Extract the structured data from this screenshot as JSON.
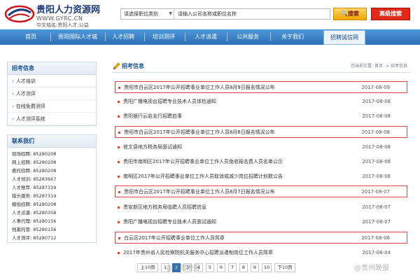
{
  "site": {
    "name": "贵阳人力资源网",
    "url": "WWW.GYRC.CN",
    "domain": "中文域名:贵阳人才.公益"
  },
  "search": {
    "category": "请选择职位类别",
    "input": "请输入公司名称或职位名称",
    "button": "搜索",
    "advanced": "高级搜索"
  },
  "nav": [
    "首页",
    "贵阳国际人才城",
    "人才招聘",
    "培训测评",
    "人才派遣",
    "公共服务",
    "关于我们",
    "招聘诚信网"
  ],
  "sidebar": {
    "recruit_title": "招考信息",
    "recruit_items": [
      "人才培训",
      "人才测评",
      "在线免费测评",
      "人才测评系统"
    ],
    "contact_title": "联系我们",
    "contacts": [
      {
        "label": "现场招聘:",
        "tel": "85280208"
      },
      {
        "label": "网上招聘:",
        "tel": "85280208"
      },
      {
        "label": "委托招聘:",
        "tel": "85280208"
      },
      {
        "label": "人才培训:",
        "tel": "85283667"
      },
      {
        "label": "人才推荐:",
        "tel": "85287319"
      },
      {
        "label": "猎头服务:",
        "tel": "85287319"
      },
      {
        "label": "报纸招聘:",
        "tel": "85280208"
      },
      {
        "label": "人才派遣:",
        "tel": "85280358"
      },
      {
        "label": "人事代理:",
        "tel": "85280156"
      },
      {
        "label": "档案托管:",
        "tel": "85280156"
      },
      {
        "label": "人才测评:",
        "tel": "85280712"
      }
    ]
  },
  "main": {
    "title": "招考信息",
    "breadcrumb": "您当前位置: 首页 -> 招考信息",
    "rows": [
      {
        "text": "贵阳市白云区2017年公开招聘事业单位工作人员8月9日报名情况公布",
        "date": "2017-08-09",
        "highlight": true
      },
      {
        "text": "贵阳广播电视台招聘专业技术人员体检通知",
        "date": "2017-08-08",
        "highlight": false
      },
      {
        "text": "贵阳银行云岩支行招聘启事",
        "date": "2017-08-08",
        "highlight": false
      },
      {
        "text": "贵阳市白云区2017年公开招聘事业单位工作人员8月8日报名情况公布",
        "date": "2017-08-08",
        "highlight": true
      },
      {
        "text": "修文县地方税务局面试通知",
        "date": "2017-08-08",
        "highlight": false
      },
      {
        "text": "贵阳市南明区2017年公开招聘事业单位工作人员免收报名费人员名单公示",
        "date": "2017-08-08",
        "highlight": false
      },
      {
        "text": "南明区2017年公开招聘事业单位工作人员取消或减少岗位招聘计划数公告",
        "date": "2017-08-08",
        "highlight": false
      },
      {
        "text": "贵阳市白云区2017年公开招聘事业单位工作人员8月7日报名情况公布",
        "date": "2017-08-07",
        "highlight": true
      },
      {
        "text": "贵安新区地方税务局临聘人员招聘信息",
        "date": "2017-08-07",
        "highlight": false
      },
      {
        "text": "贵阳广播电视台招聘专业技术人员面试通知",
        "date": "2017-08-07",
        "highlight": false
      },
      {
        "text": "白云区2017年公开招聘事业单位工作人员简章",
        "date": "2017-08-06",
        "highlight": true
      },
      {
        "text": "2017年贵州省人民检察院机关服务中心招聘派遣制岗位工作人员简章",
        "date": "2017-08-04",
        "highlight": false
      }
    ]
  },
  "pager": {
    "prev": "上10页",
    "pages": [
      "1",
      "2",
      "3",
      "4",
      "5",
      "6",
      "7",
      "8",
      "9",
      "10"
    ],
    "next": "下10页"
  },
  "watermarks": [
    "@贵阳晚报",
    "@贵州晚报"
  ]
}
